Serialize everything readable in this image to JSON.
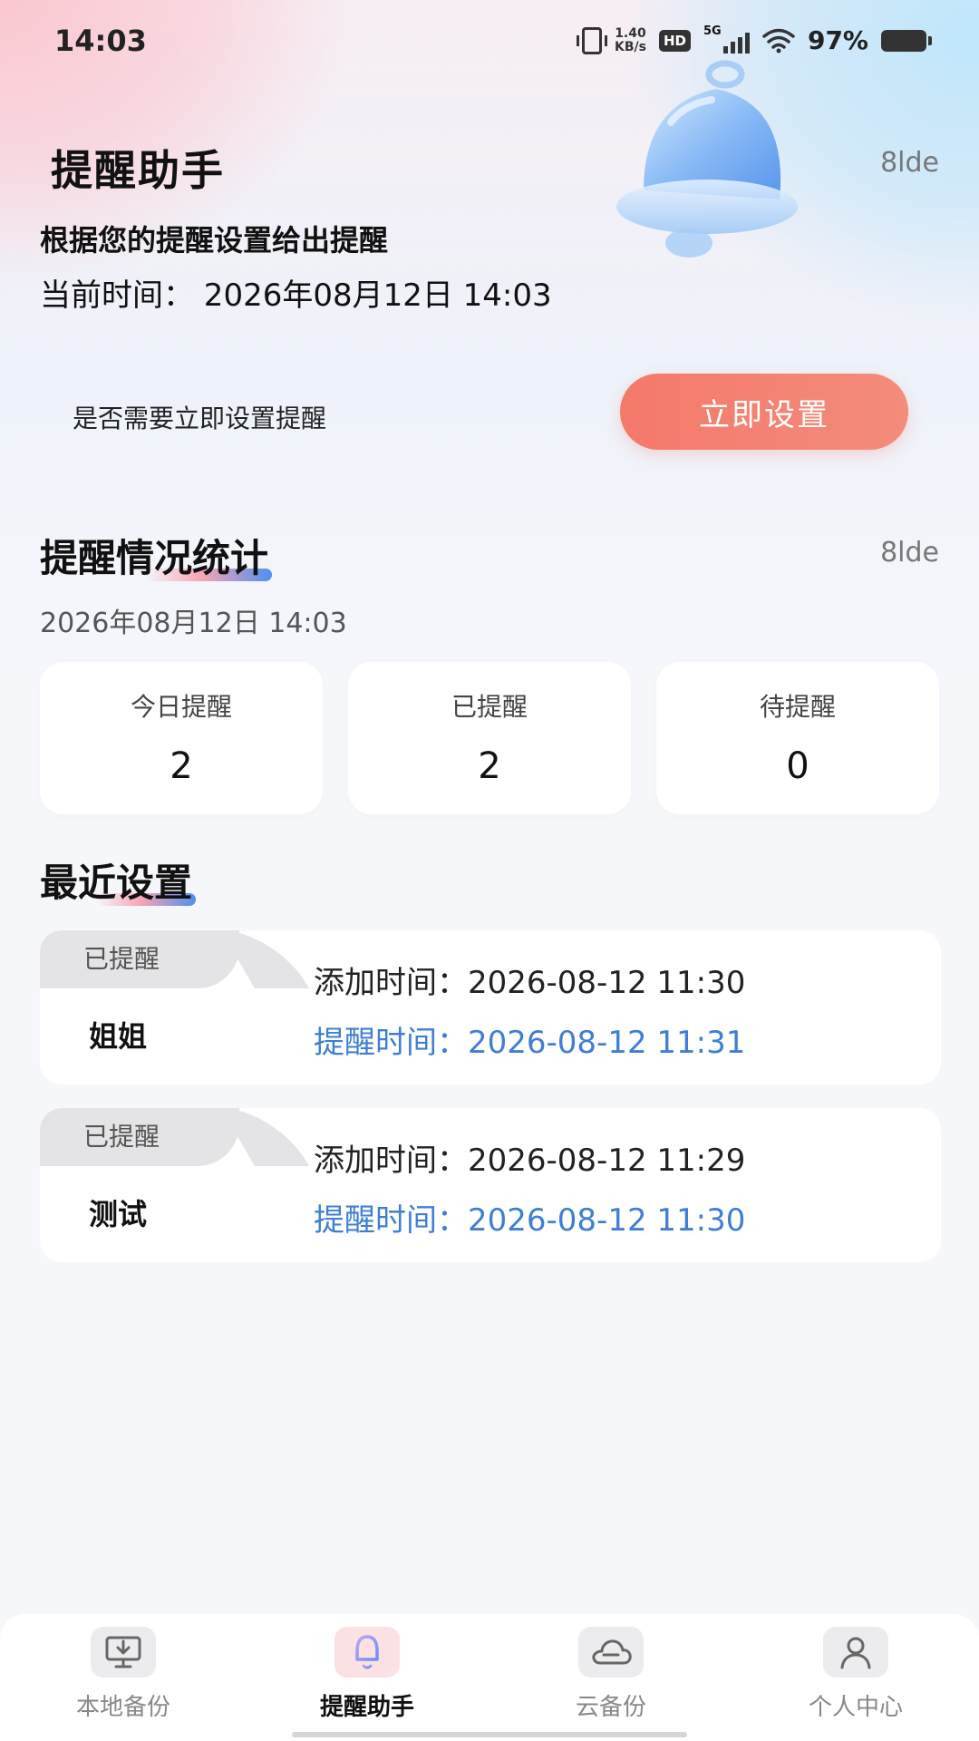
{
  "status_bar": {
    "time": "14:03",
    "speed_value": "1.40",
    "speed_unit": "KB/s",
    "hd": "HD",
    "network": "5G",
    "battery": "97%"
  },
  "hero": {
    "title": "提醒助手",
    "brand_mark": "8lde",
    "subtitle": "根据您的提醒设置给出提醒",
    "current_time": "当前时间：  2026年08月12日 14:03",
    "prompt": "是否需要立即设置提醒",
    "setup_button": "立即设置"
  },
  "stats": {
    "title": "提醒情况统计",
    "brand_mark": "8lde",
    "date": "2026年08月12日 14:03",
    "cards": [
      {
        "label": "今日提醒",
        "value": "2"
      },
      {
        "label": "已提醒",
        "value": "2"
      },
      {
        "label": "待提醒",
        "value": "0"
      }
    ]
  },
  "recent": {
    "title": "最近设置",
    "items": [
      {
        "tag": "已提醒",
        "name": "姐姐",
        "added": "添加时间：2026-08-12 11:30",
        "remind": "提醒时间：2026-08-12 11:31"
      },
      {
        "tag": "已提醒",
        "name": "测试",
        "added": "添加时间：2026-08-12 11:29",
        "remind": "提醒时间：2026-08-12 11:30"
      }
    ]
  },
  "nav": {
    "items": [
      {
        "label": "本地备份",
        "icon": "monitor-download-icon"
      },
      {
        "label": "提醒助手",
        "icon": "bell-icon",
        "active": true
      },
      {
        "label": "云备份",
        "icon": "cloud-icon"
      },
      {
        "label": "个人中心",
        "icon": "person-icon"
      }
    ]
  },
  "colors": {
    "accent": "#f4796a",
    "link_blue": "#3f7fd3",
    "tag_gray": "#e4e4e6"
  }
}
